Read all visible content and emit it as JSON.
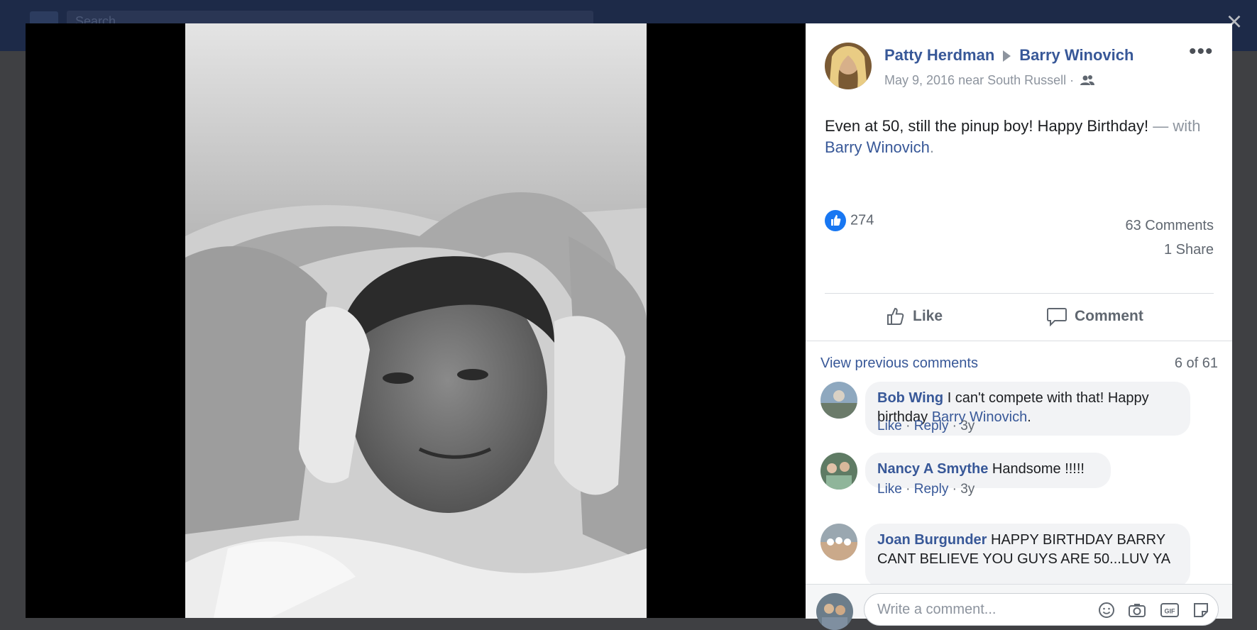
{
  "topbar": {
    "search_placeholder": "Search"
  },
  "viewer": {
    "close_glyph": "×"
  },
  "post": {
    "author": "Patty Herdman",
    "recipient": "Barry Winovich",
    "date_location": "May 9, 2016 near South Russell ·",
    "more_glyph": "•••",
    "text_main": "Even at 50, still the pinup boy! Happy Birthday!",
    "text_with_prefix": " — with ",
    "text_with_name": "Barry Winovich",
    "text_end": ".",
    "like_count": "274",
    "comments_count": "63 Comments",
    "shares_count": "1 Share",
    "actions": {
      "like": "Like",
      "comment": "Comment"
    }
  },
  "comments_section": {
    "view_previous": "View previous comments",
    "page_info": "6 of 61",
    "items": [
      {
        "author": "Bob Wing",
        "text": "I can't compete with that! Happy birthday ",
        "mention": "Barry Winovich",
        "end": ".",
        "like": "Like",
        "reply": "Reply",
        "time": "3y"
      },
      {
        "author": "Nancy A Smythe",
        "text": "Handsome !!!!!",
        "like": "Like",
        "reply": "Reply",
        "time": "3y"
      },
      {
        "author": "Joan Burgunder",
        "text": "HAPPY BIRTHDAY BARRY CANT BELIEVE YOU GUYS ARE 50...LUV YA"
      }
    ],
    "separator": "·"
  },
  "composer": {
    "placeholder": "Write a comment...",
    "icons": [
      "emoji-icon",
      "camera-icon",
      "gif-icon",
      "sticker-icon"
    ]
  },
  "colors": {
    "link": "#385898",
    "muted": "#606770",
    "like_blue": "#1877f2",
    "topbar": "#1d2a48"
  }
}
